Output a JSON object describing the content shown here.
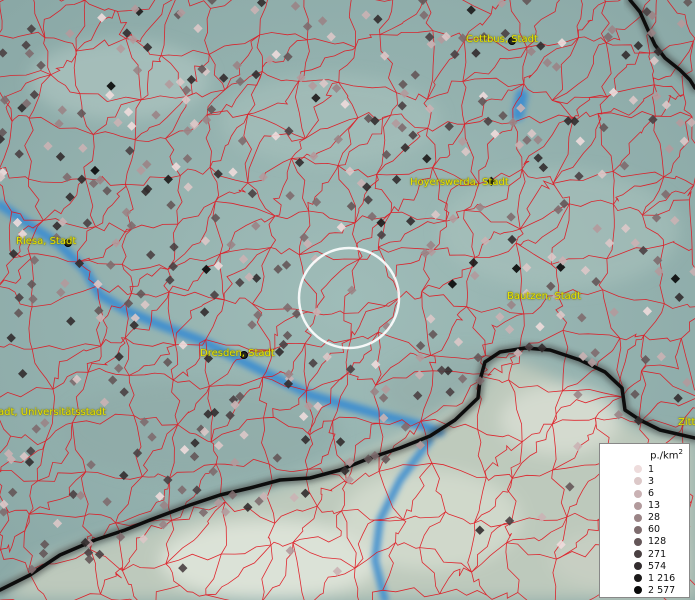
{
  "map": {
    "cities": [
      {
        "id": "cottbus",
        "name": "Cottbus, Stadt"
      },
      {
        "id": "hoyerswerda",
        "name": "Hoyerswerda, Stadt"
      },
      {
        "id": "riesa",
        "name": "Riesa, Stadt"
      },
      {
        "id": "bautzen",
        "name": "Bautzen, Stadt"
      },
      {
        "id": "dresden",
        "name": "Dresden, Stadt"
      },
      {
        "id": "universitaetsstadt",
        "name": "adt, Universitätsstadt"
      },
      {
        "id": "zittau",
        "name": "Zitta"
      }
    ],
    "colors": {
      "terrain": "#9fb8b6",
      "boundaries": "#e0141e",
      "rivers": "#3f8fcf",
      "border": "#111111",
      "label": "#e8e400",
      "selection_ring": "#ffffff"
    }
  },
  "legend": {
    "title": "p./km",
    "title_sup": "2",
    "entries": [
      {
        "label": "1",
        "color": "#eedcdc"
      },
      {
        "label": "3",
        "color": "#dcc8c8"
      },
      {
        "label": "6",
        "color": "#cab2b4"
      },
      {
        "label": "13",
        "color": "#b29a9c"
      },
      {
        "label": "28",
        "color": "#9a8486"
      },
      {
        "label": "60",
        "color": "#7e6c6e"
      },
      {
        "label": "128",
        "color": "#645658"
      },
      {
        "label": "271",
        "color": "#4a4042"
      },
      {
        "label": "574",
        "color": "#322c2e"
      },
      {
        "label": "1 216",
        "color": "#1c1a1a"
      },
      {
        "label": "2 577",
        "color": "#080808"
      }
    ]
  }
}
